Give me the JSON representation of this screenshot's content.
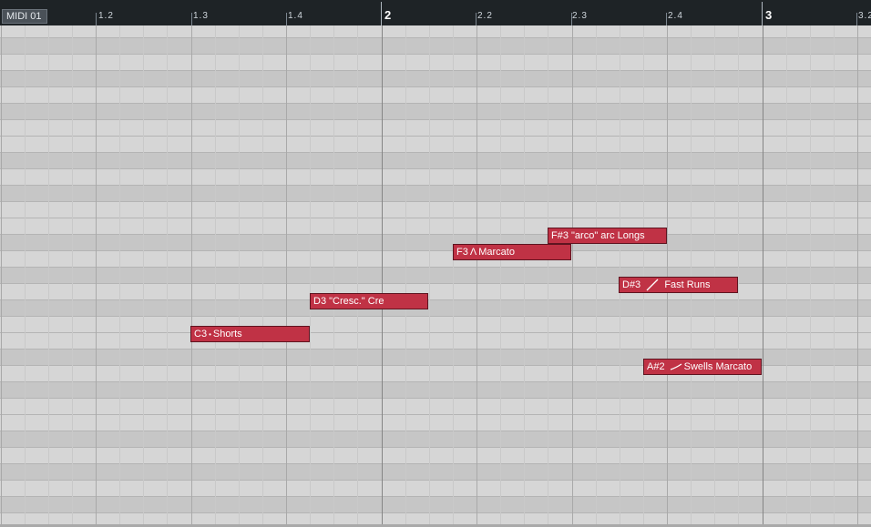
{
  "track": {
    "name": "MIDI 01"
  },
  "ruler": {
    "labels": [
      "1.2",
      "1.3",
      "1.4",
      "2",
      "2.2",
      "2.3",
      "2.4",
      "3",
      "3.2"
    ]
  },
  "notes": [
    {
      "pitch": "F#3",
      "articulation_symbol": "",
      "label": "\"arco\" arc Longs"
    },
    {
      "pitch": "F3",
      "articulation_symbol": "Λ",
      "label": "Marcato"
    },
    {
      "pitch": "D#3",
      "articulation_symbol": "slash-icon",
      "label": "Fast Runs"
    },
    {
      "pitch": "D3",
      "articulation_symbol": "",
      "label": "\"Cresc.\" Cre"
    },
    {
      "pitch": "C3",
      "articulation_symbol": "•",
      "label": "Shorts"
    },
    {
      "pitch": "A#2",
      "articulation_symbol": "swell-icon",
      "label": "Swells Marcato"
    }
  ],
  "colors": {
    "note_fill": "#c03245",
    "grid_light": "#d6d6d6",
    "grid_dark": "#c6c6c6",
    "ruler_bg": "#1e2326"
  }
}
